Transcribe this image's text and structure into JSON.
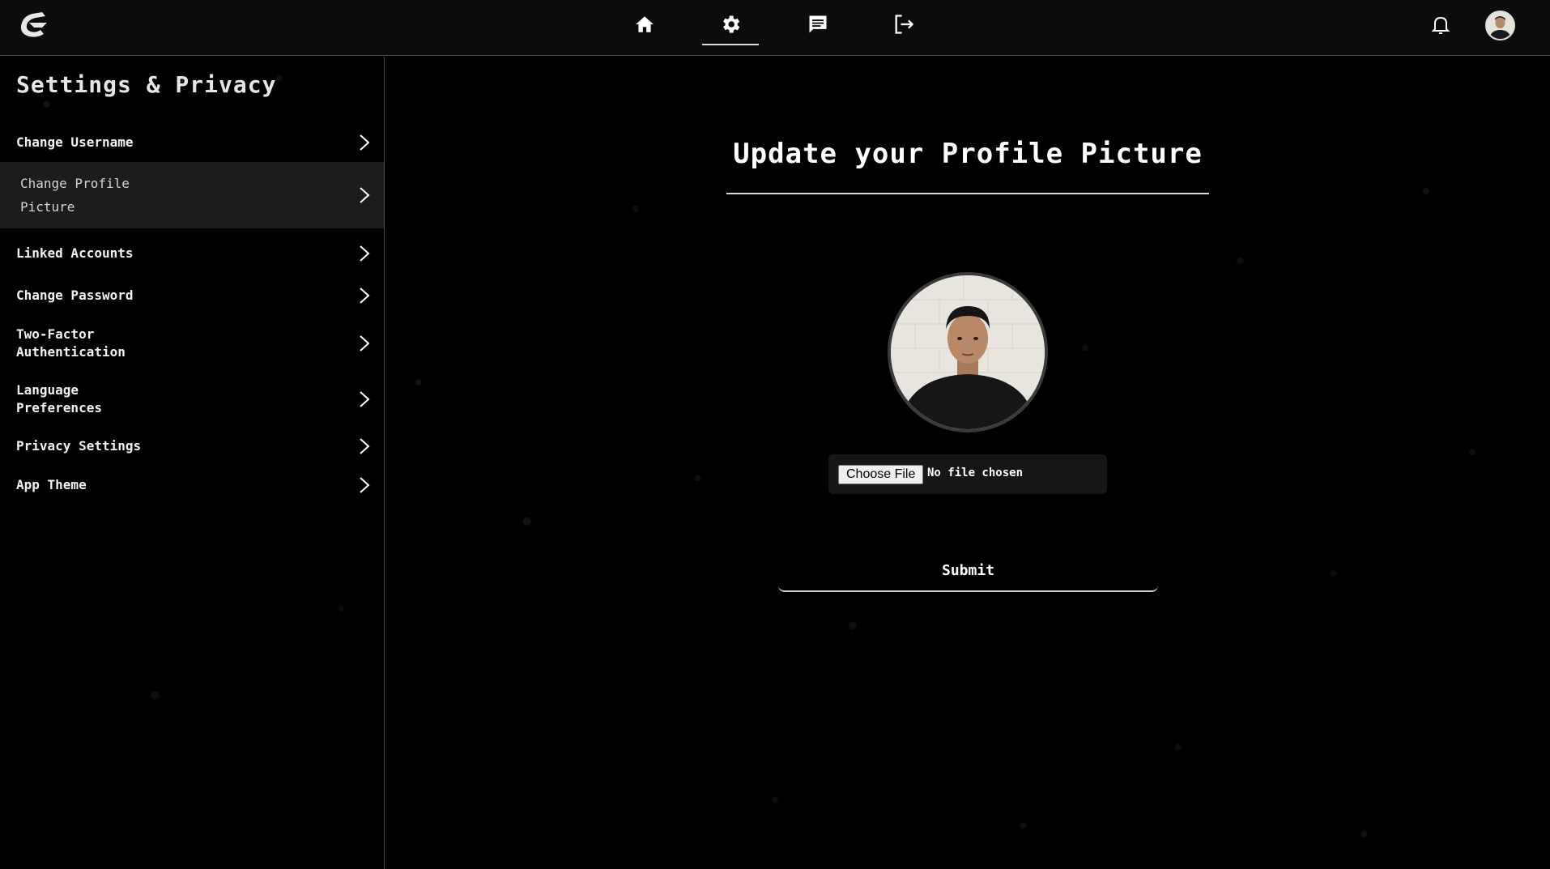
{
  "topbar": {
    "nav": [
      {
        "icon": "home-icon",
        "active": false
      },
      {
        "icon": "gear-icon",
        "active": true
      },
      {
        "icon": "chat-icon",
        "active": false
      },
      {
        "icon": "logout-icon",
        "active": false
      }
    ],
    "notification_icon": "bell-icon",
    "avatar": "user-avatar"
  },
  "sidebar": {
    "title": "Settings & Privacy",
    "items": [
      {
        "label": "Change Username"
      },
      {
        "label": "Change Profile Picture",
        "active": true
      },
      {
        "label": "Linked Accounts"
      },
      {
        "label": "Change Password"
      },
      {
        "label": "Two-Factor Authentication"
      },
      {
        "label": "Language Preferences"
      },
      {
        "label": "Privacy Settings"
      },
      {
        "label": "App Theme"
      }
    ]
  },
  "main": {
    "title": "Update your Profile Picture",
    "file_input": {
      "button_label": "Choose File",
      "status": "No file chosen"
    },
    "submit_label": "Submit"
  },
  "colors": {
    "background": "#000000",
    "topbar": "#0c0c0c",
    "active_item": "#1c1c1c",
    "text": "#ffffff"
  }
}
